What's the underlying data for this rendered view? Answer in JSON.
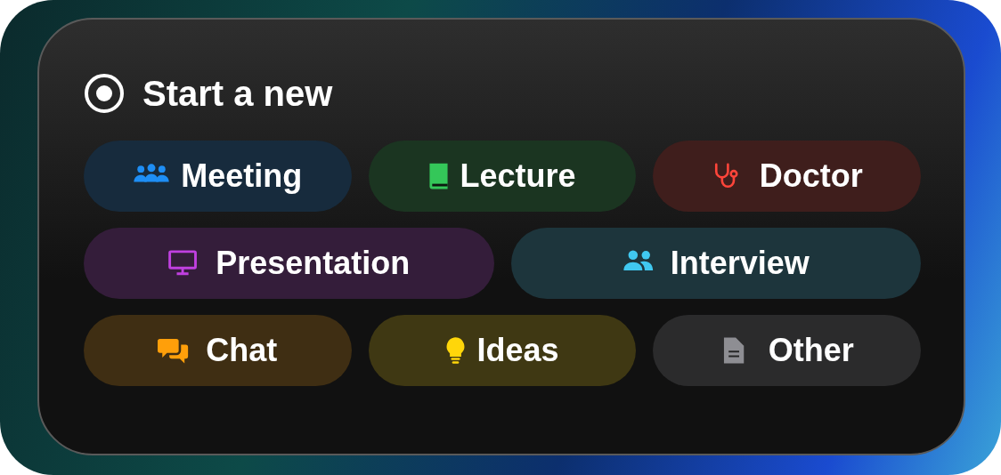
{
  "header": {
    "title": "Start a new"
  },
  "rows": [
    {
      "options": [
        {
          "label": "Meeting",
          "color": "#1e8ef5"
        },
        {
          "label": "Lecture",
          "color": "#34c759"
        },
        {
          "label": "Doctor",
          "color": "#ff453a"
        }
      ]
    },
    {
      "options": [
        {
          "label": "Presentation",
          "color": "#c040e0"
        },
        {
          "label": "Interview",
          "color": "#40c8f0"
        }
      ]
    },
    {
      "options": [
        {
          "label": "Chat",
          "color": "#ff9f0a"
        },
        {
          "label": "Ideas",
          "color": "#ffd60a"
        },
        {
          "label": "Other",
          "color": "#8e8e93"
        }
      ]
    }
  ]
}
